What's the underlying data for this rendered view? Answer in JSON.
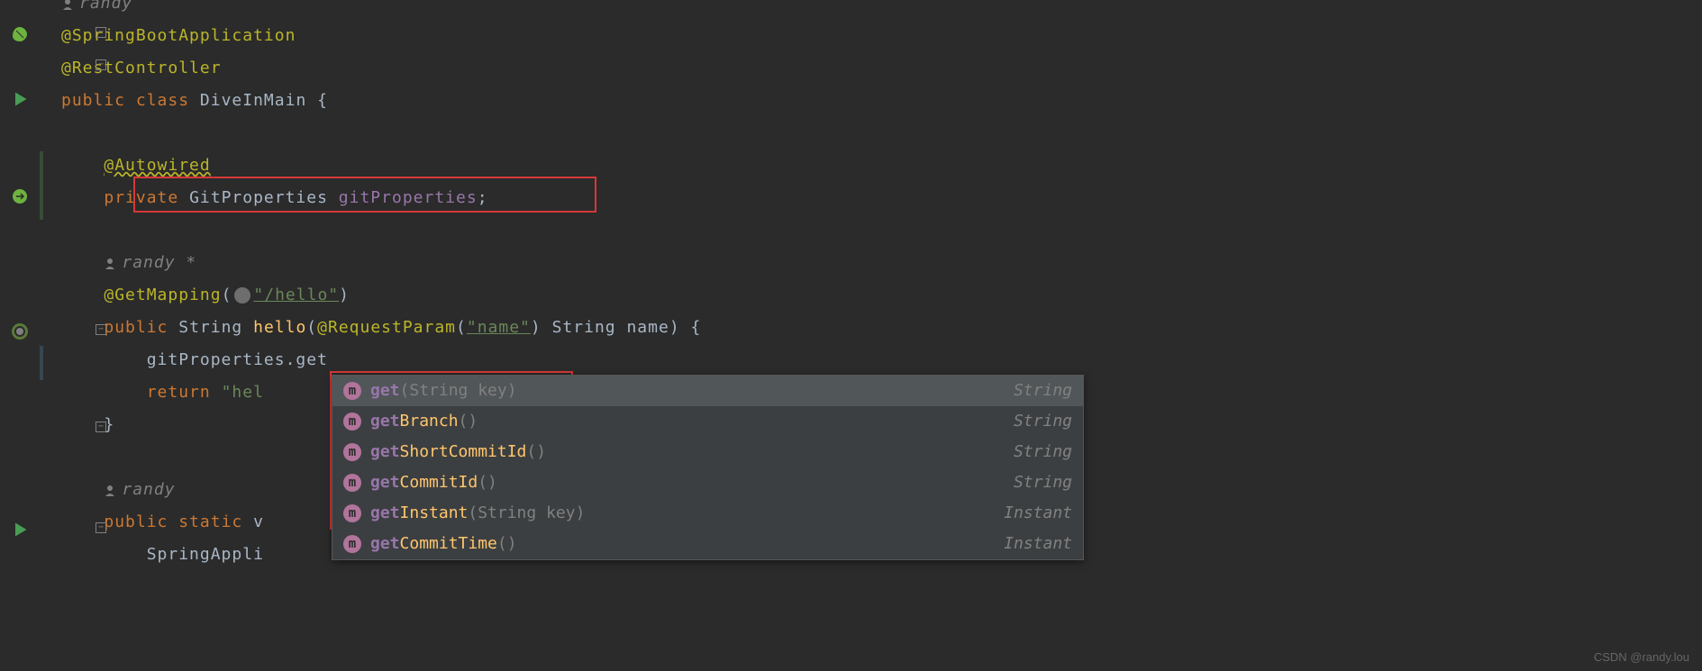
{
  "code": {
    "author1": "randy",
    "ann_springboot": "@SpringBootApplication",
    "ann_restcontroller": "@RestController",
    "kw_public": "public",
    "kw_class": "class",
    "classname": "DiveInMain",
    "brace_open": "{",
    "brace_close": "}",
    "ann_autowired": "@Autowired",
    "kw_private": "private",
    "type_gitprops": "GitProperties",
    "field_gitprops": "gitProperties",
    "semicolon": ";",
    "author_randy_star": "randy *",
    "ann_getmapping": "@GetMapping",
    "str_hello_path": "\"/hello\"",
    "type_string": "String",
    "method_hello": "hello",
    "ann_reqparam": "@RequestParam",
    "str_name": "\"name\"",
    "param_name": "name",
    "call_line": "gitProperties.get",
    "kw_return": "return",
    "str_hel": "\"hel",
    "author_randy": "randy",
    "kw_static": "static",
    "method_v": "v",
    "call_springappl": "SpringAppli"
  },
  "autocomplete": [
    {
      "name": "get",
      "bold": "get",
      "rest": "",
      "params": "(String key)",
      "type": "String",
      "selected": true
    },
    {
      "name": "getBranch",
      "bold": "get",
      "rest": "Branch",
      "params": "()",
      "type": "String",
      "selected": false
    },
    {
      "name": "getShortCommitId",
      "bold": "get",
      "rest": "ShortCommitId",
      "params": "()",
      "type": "String",
      "selected": false
    },
    {
      "name": "getCommitId",
      "bold": "get",
      "rest": "CommitId",
      "params": "()",
      "type": "String",
      "selected": false
    },
    {
      "name": "getInstant",
      "bold": "get",
      "rest": "Instant",
      "params": "(String key)",
      "type": "Instant",
      "selected": false
    },
    {
      "name": "getCommitTime",
      "bold": "get",
      "rest": "CommitTime",
      "params": "()",
      "type": "Instant",
      "selected": false
    }
  ],
  "watermark": "CSDN @randy.lou"
}
